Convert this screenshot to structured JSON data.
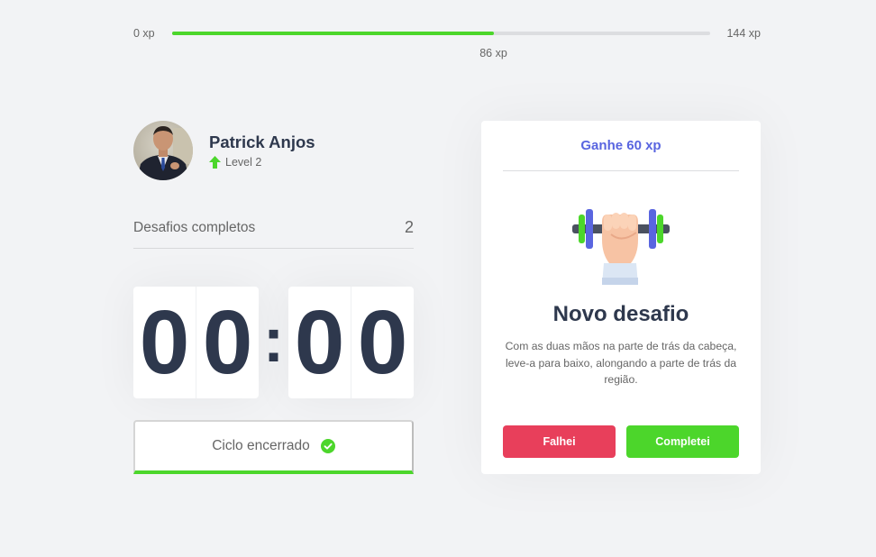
{
  "xp": {
    "min_label": "0 xp",
    "max_label": "144 xp",
    "current_label": "86 xp",
    "current": 86,
    "max": 144,
    "accent_color": "#4cd62b"
  },
  "profile": {
    "name": "Patrick Anjos",
    "level_label": "Level 2",
    "avatar_icon": "user-photo",
    "level_icon": "level-up-arrow-icon"
  },
  "completed_challenges": {
    "label": "Desafios completos",
    "value": "2"
  },
  "countdown": {
    "minute_left": "0",
    "minute_right": "0",
    "separator": ":",
    "second_left": "0",
    "second_right": "0"
  },
  "cycle": {
    "label": "Ciclo encerrado",
    "status_icon": "check-circle-icon",
    "status_color": "#4cd62b"
  },
  "challenge": {
    "header": "Ganhe 60 xp",
    "icon": "dumbbell-lift-icon",
    "title": "Novo desafio",
    "description": "Com as duas mãos na parte de trás da cabeça, leve-a para baixo, alongando a parte de trás da região.",
    "fail_label": "Falhei",
    "success_label": "Completei",
    "fail_color": "#e83f5b",
    "success_color": "#4cd62b",
    "header_color": "#5965e0"
  }
}
